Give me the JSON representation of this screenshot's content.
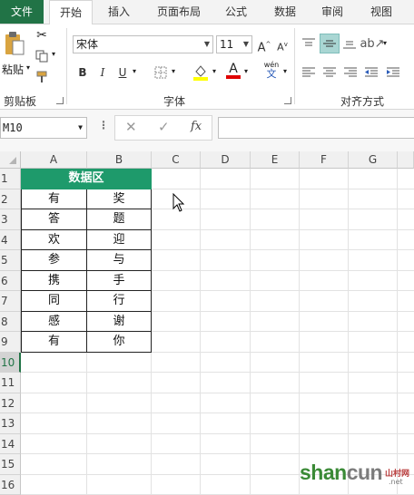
{
  "ribbon_tabs": [
    "文件",
    "开始",
    "插入",
    "页面布局",
    "公式",
    "数据",
    "审阅",
    "视图"
  ],
  "clipboard": {
    "paste_label": "粘贴",
    "group_label": "剪贴板"
  },
  "font": {
    "name": "宋体",
    "size": "11",
    "group_label": "字体",
    "bold": "B",
    "italic": "I",
    "underline": "U",
    "phonetic_top": "wén",
    "phonetic_bottom": "文"
  },
  "align": {
    "group_label": "对齐方式"
  },
  "formula_bar": {
    "name_box": "M10",
    "fx": "fx",
    "formula": ""
  },
  "columns": [
    "A",
    "B",
    "C",
    "D",
    "E",
    "F",
    "G"
  ],
  "rows": [
    "1",
    "2",
    "3",
    "4",
    "5",
    "6",
    "7",
    "8",
    "9",
    "10",
    "11",
    "12",
    "13",
    "14",
    "15",
    "16"
  ],
  "selected_row": "10",
  "table": {
    "header": "数据区",
    "rows": [
      [
        "有",
        "奖"
      ],
      [
        "答",
        "题"
      ],
      [
        "欢",
        "迎"
      ],
      [
        "参",
        "与"
      ],
      [
        "携",
        "手"
      ],
      [
        "同",
        "行"
      ],
      [
        "感",
        "谢"
      ],
      [
        "有",
        "你"
      ]
    ]
  },
  "watermark": {
    "main_green": "shan",
    "main_gray": "cun",
    "cn": "山村网",
    "net": ".net"
  },
  "colors": {
    "excel_green": "#217346",
    "table_header": "#1e9a6b"
  }
}
